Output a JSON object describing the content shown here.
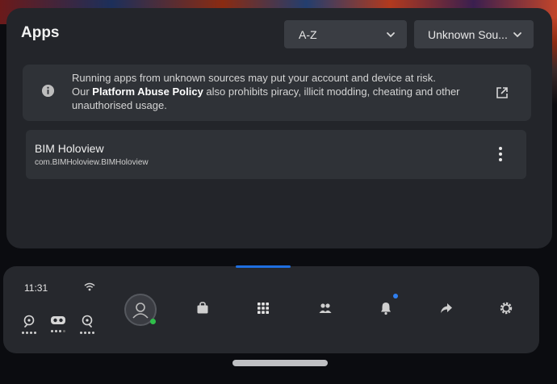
{
  "panel": {
    "title": "Apps",
    "sort_dropdown": {
      "selected": "A-Z"
    },
    "source_dropdown": {
      "selected": "Unknown Sou..."
    },
    "notice": {
      "line1": "Running apps from unknown sources may put your account and device at risk.",
      "prefix": "Our ",
      "policy_link": "Platform Abuse Policy",
      "suffix": " also prohibits piracy, illicit modding, cheating and other unauthorised usage."
    },
    "apps": [
      {
        "name": "BIM Holoview",
        "package": "com.BIMHoloview.BIMHoloview"
      }
    ]
  },
  "taskbar": {
    "time": "11:31",
    "quick_actions": [
      {
        "icon": "headset-pin-icon",
        "dots": 4
      },
      {
        "icon": "vr-goggles-icon",
        "dots": 4
      },
      {
        "icon": "headset-pin-icon",
        "dots": 4
      }
    ],
    "nav": [
      "avatar",
      "store-bag-icon",
      "apps-grid-icon",
      "people-icon",
      "notifications-bell-icon",
      "share-icon",
      "settings-gear-icon"
    ]
  },
  "colors": {
    "panel": "#23252a",
    "card": "#2f3237",
    "accent": "#1f6fe0",
    "online": "#2fbf4a"
  }
}
